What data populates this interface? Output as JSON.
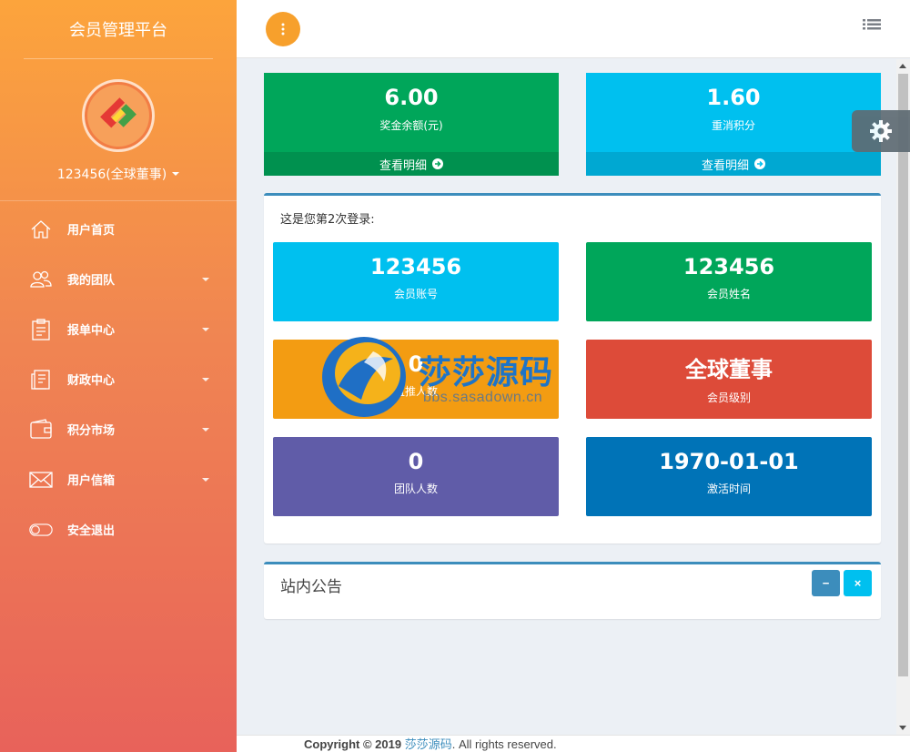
{
  "sidebar": {
    "brand": "会员管理平台",
    "user_name": "123456(全球董事)",
    "items": [
      {
        "label": "用户首页",
        "icon": "home-icon",
        "has_sub": false
      },
      {
        "label": "我的团队",
        "icon": "team-icon",
        "has_sub": true
      },
      {
        "label": "报单中心",
        "icon": "clipboard-icon",
        "has_sub": true
      },
      {
        "label": "财政中心",
        "icon": "finance-icon",
        "has_sub": true
      },
      {
        "label": "积分市场",
        "icon": "wallet-icon",
        "has_sub": true
      },
      {
        "label": "用户信箱",
        "icon": "mail-icon",
        "has_sub": true
      },
      {
        "label": "安全退出",
        "icon": "toggle-icon",
        "has_sub": false
      }
    ]
  },
  "stats": [
    {
      "value": "6.00",
      "label": "奖金余额(元)",
      "link": "查看明细",
      "color": "#00a65a"
    },
    {
      "value": "1.60",
      "label": "重消积分",
      "link": "查看明细",
      "color": "#00c0ef"
    }
  ],
  "login_box": {
    "message": "这是您第2次登录:",
    "tiles": [
      {
        "value": "123456",
        "label": "会员账号",
        "color": "#00c0ef"
      },
      {
        "value": "123456",
        "label": "会员姓名",
        "color": "#00a65a"
      },
      {
        "value": "0",
        "label": "直推人数",
        "color": "#f39c12"
      },
      {
        "value": "全球董事",
        "label": "会员级别",
        "color": "#dd4b39"
      },
      {
        "value": "0",
        "label": "团队人数",
        "color": "#605ca8"
      },
      {
        "value": "1970-01-01",
        "label": "激活时间",
        "color": "#0073b7"
      }
    ]
  },
  "notice": {
    "title": "站内公告",
    "minimize": "−",
    "close": "×"
  },
  "watermark": {
    "text": "莎莎源码",
    "sub": "bbs.sasadown.cn"
  },
  "footer": {
    "prefix": "Copyright © 2019 ",
    "link": "莎莎源码",
    "suffix": ". All rights reserved."
  }
}
